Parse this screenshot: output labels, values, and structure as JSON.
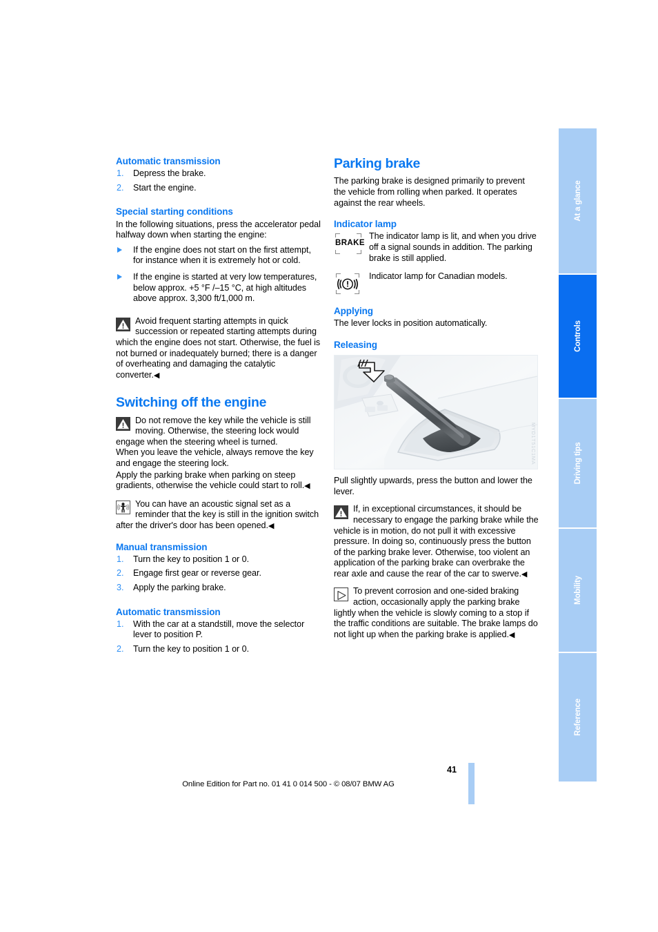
{
  "meta": {
    "page_number": "41",
    "footer_text": "Online Edition for Part no. 01 41 0 014 500 - © 08/07 BMW AG",
    "accent_blue": "#0a78f0",
    "list_blue": "#2f90f5",
    "tab_active_blue": "#0a6ef0",
    "tab_inactive_blue": "#a8cdf5"
  },
  "sidebar": {
    "tabs": [
      {
        "label": "At a glance",
        "active": false
      },
      {
        "label": "Controls",
        "active": true
      },
      {
        "label": "Driving tips",
        "active": false
      },
      {
        "label": "Mobility",
        "active": false
      },
      {
        "label": "Reference",
        "active": false
      }
    ]
  },
  "left_column": {
    "auto_trans_heading": "Automatic transmission",
    "auto_trans_steps": [
      {
        "num": "1.",
        "text": "Depress the brake."
      },
      {
        "num": "2.",
        "text": "Start the engine."
      }
    ],
    "special_heading": "Special starting conditions",
    "special_intro": "In the following situations, press the accelerator pedal halfway down when starting the engine:",
    "special_items": [
      "If the engine does not start on the first attempt, for instance when it is extremely hot or cold.",
      "If the engine is started at very low temperatures, below approx. +5 °F /–15 °C, at high altitudes above approx. 3,300 ft/1,000 m."
    ],
    "warning_starting": "Avoid frequent starting attempts in quick succession or repeated starting attempts during which the engine does not start. Otherwise, the fuel is not burned or inadequately burned; there is a danger of overheating and damaging the catalytic converter.",
    "switching_off_heading": "Switching off the engine",
    "warning_key": "Do not remove the key while the vehicle is still moving. Otherwise, the steering lock would engage when the steering wheel is turned.",
    "switch_para_1": "When you leave the vehicle, always remove the key and engage the steering lock.",
    "switch_para_2": "Apply the parking brake when parking on steep gradients, otherwise the vehicle could start to roll.",
    "acoustic_note": "You can have an acoustic signal set as a reminder that the key is still in the ignition switch after the driver's door has been opened.",
    "manual_heading": "Manual transmission",
    "manual_steps": [
      {
        "num": "1.",
        "text": "Turn the key to position 1 or 0."
      },
      {
        "num": "2.",
        "text": "Engage first gear or reverse gear."
      },
      {
        "num": "3.",
        "text": "Apply the parking brake."
      }
    ],
    "auto_heading_2": "Automatic transmission",
    "auto_steps_2": [
      {
        "num": "1.",
        "text": "With the car at a standstill, move the selector lever to position P."
      },
      {
        "num": "2.",
        "text": "Turn the key to position 1 or 0."
      }
    ]
  },
  "right_column": {
    "parking_brake_heading": "Parking brake",
    "parking_brake_intro": "The parking brake is designed primarily to prevent the vehicle from rolling when parked. It operates against the rear wheels.",
    "indicator_lamp_heading": "Indicator lamp",
    "lamp_brake_label": "BRAKE",
    "lamp_brake_text": "The indicator lamp is lit, and when you drive off a signal sounds in addition. The parking brake is still applied.",
    "lamp_canada_text": "Indicator lamp for Canadian models.",
    "applying_heading": "Applying",
    "applying_text": "The lever locks in position automatically.",
    "releasing_heading": "Releasing",
    "photo_code": "MYD1T51C1MA",
    "releasing_text": "Pull slightly upwards, press the button and lower the lever.",
    "warning_motion": "If, in exceptional circumstances, it should be necessary to engage the parking brake while the vehicle is in motion, do not pull it with excessive pressure. In doing so, continuously press the button of the parking brake lever. Otherwise, too violent an application of the parking brake can overbrake the rear axle and cause the rear of the car to swerve.",
    "note_corrosion": "To prevent corrosion and one-sided braking action, occasionally apply the parking brake lightly when the vehicle is slowly coming to a stop if the traffic conditions are suitable. The brake lamps do not light up when the parking brake is applied."
  }
}
